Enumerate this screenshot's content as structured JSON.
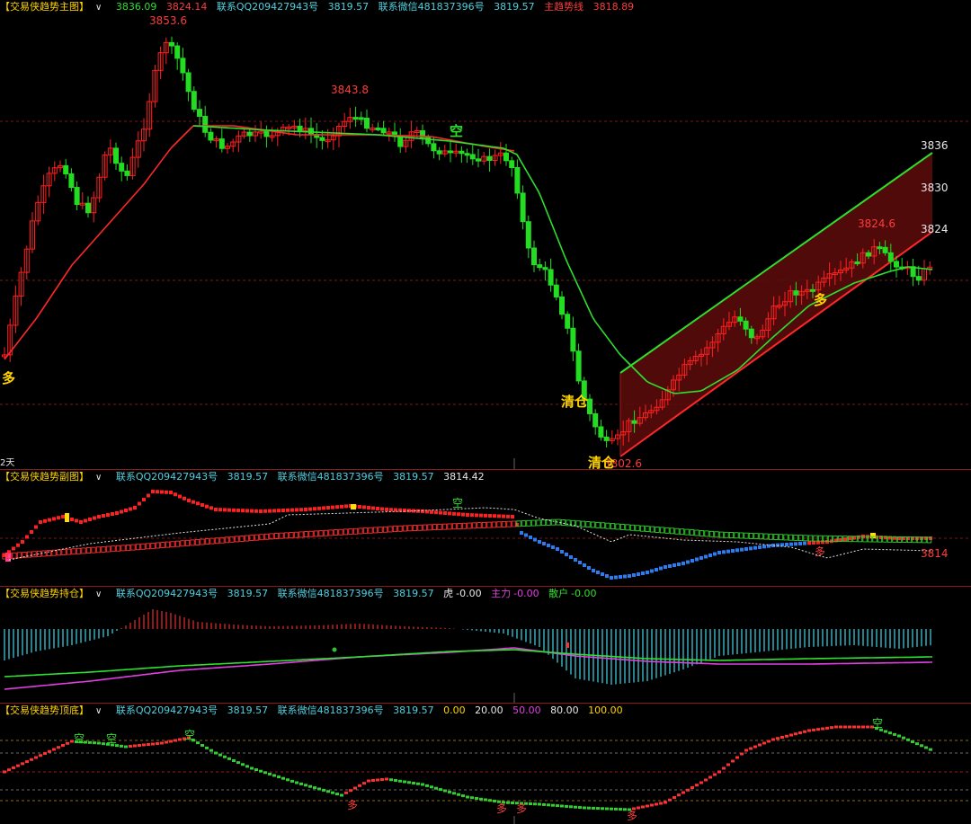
{
  "main": {
    "title": "【交易侠趋势主图】",
    "v1": "3836.09",
    "v2": "3824.14",
    "contact_qq": "联系QQ209427943号",
    "v3": "3819.57",
    "contact_wx": "联系微信481837396号",
    "v4": "3819.57",
    "trend_label": "主趋势线",
    "v5": "3818.89",
    "peak1": "3853.6",
    "peak2": "3843.8",
    "peak3": "3824.6",
    "low_val": "3802.6",
    "axis": [
      "3836",
      "3830",
      "3824"
    ],
    "duo": "多",
    "kong": "空",
    "qingcang": "清仓",
    "period": "2天",
    "colors": {
      "up": "#ff2020",
      "down": "#22dd22",
      "ma_red": "#ff2828",
      "ma_green": "#2ee02e"
    }
  },
  "sub": {
    "title": "【交易侠趋势副图】",
    "contact_qq": "联系QQ209427943号",
    "v1": "3819.57",
    "contact_wx": "联系微信481837396号",
    "v2": "3819.57",
    "v3": "3814.42",
    "right_val": "3814",
    "kong": "空",
    "duo": "多"
  },
  "pos": {
    "title": "【交易侠趋势持仓】",
    "contact_qq": "联系QQ209427943号",
    "v1": "3819.57",
    "contact_wx": "联系微信481837396号",
    "v2": "3819.57",
    "hu_label": "虎",
    "hu_val": "-0.00",
    "zhuli_label": "主力",
    "zhuli_val": "-0.00",
    "sanhu_label": "散户",
    "sanhu_val": "-0.00"
  },
  "top": {
    "title": "【交易侠趋势顶底】",
    "contact_qq": "联系QQ209427943号",
    "v1": "3819.57",
    "contact_wx": "联系微信481837396号",
    "v2": "3819.57",
    "vals": [
      "80.00",
      "0.00",
      "20.00",
      "50.00",
      "100.00"
    ],
    "kong": "空",
    "duo": "多"
  }
}
